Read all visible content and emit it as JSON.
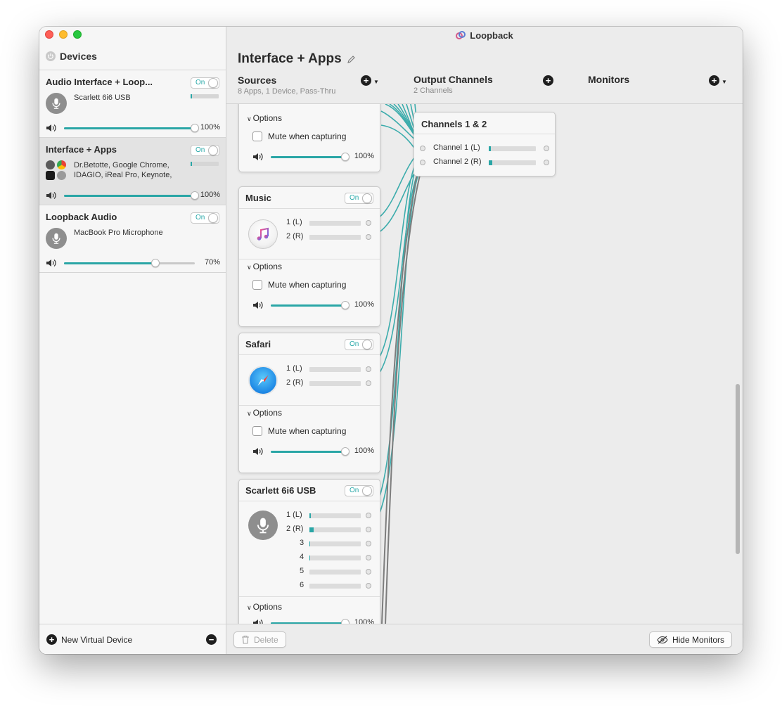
{
  "window": {
    "app_title": "Loopback",
    "colors": {
      "accent": "#2aa6a6",
      "wire_gray": "#7d7d7d"
    }
  },
  "sidebar": {
    "header": "Devices",
    "devices": [
      {
        "name": "Audio Interface + Loop...",
        "toggle": "On",
        "subtitle": "Scarlett 6i6 USB",
        "volume": "100%",
        "volume_value": 1.0,
        "level": 0.05
      },
      {
        "name": "Interface + Apps",
        "toggle": "On",
        "subtitle": "Dr.Betotte, Google Chrome, IDAGIO, iReal Pro, Keynote,",
        "volume": "100%",
        "volume_value": 1.0,
        "level": 0.05
      },
      {
        "name": "Loopback Audio",
        "toggle": "On",
        "subtitle": "MacBook Pro Microphone",
        "volume": "70%",
        "volume_value": 0.7,
        "level": 0.0
      }
    ],
    "new_device_label": "New Virtual Device"
  },
  "main": {
    "title": "Interface + Apps",
    "sources": {
      "heading": "Sources",
      "subtitle": "8 Apps, 1 Device, Pass-Thru"
    },
    "outputs": {
      "heading": "Output Channels",
      "subtitle": "2 Channels"
    },
    "monitors": {
      "heading": "Monitors"
    },
    "partial_card": {
      "options_label": "Options",
      "mute_label": "Mute when capturing",
      "volume": "100%"
    },
    "cards": [
      {
        "name": "Music",
        "toggle": "On",
        "icon": "music-icon",
        "channels": [
          {
            "label": "1 (L)",
            "level": 0
          },
          {
            "label": "2 (R)",
            "level": 0
          }
        ],
        "options_label": "Options",
        "mute_label": "Mute when capturing",
        "volume": "100%"
      },
      {
        "name": "Safari",
        "toggle": "On",
        "icon": "safari-icon",
        "channels": [
          {
            "label": "1 (L)",
            "level": 0
          },
          {
            "label": "2 (R)",
            "level": 0
          }
        ],
        "options_label": "Options",
        "mute_label": "Mute when capturing",
        "volume": "100%"
      },
      {
        "name": "Scarlett 6i6 USB",
        "toggle": "On",
        "icon": "microphone-icon",
        "channels": [
          {
            "label": "1 (L)",
            "level": 0.03
          },
          {
            "label": "2 (R)",
            "level": 0.08
          },
          {
            "label": "3",
            "level": 0.01
          },
          {
            "label": "4",
            "level": 0.01
          },
          {
            "label": "5",
            "level": 0
          },
          {
            "label": "6",
            "level": 0
          }
        ],
        "options_label": "Options",
        "volume": "100%"
      }
    ],
    "output_card": {
      "name": "Channels 1 & 2",
      "channels": [
        {
          "label": "Channel 1 (L)",
          "level": 0.04
        },
        {
          "label": "Channel 2 (R)",
          "level": 0.08
        }
      ]
    },
    "buttons": {
      "delete": "Delete",
      "hide_monitors": "Hide Monitors"
    }
  }
}
